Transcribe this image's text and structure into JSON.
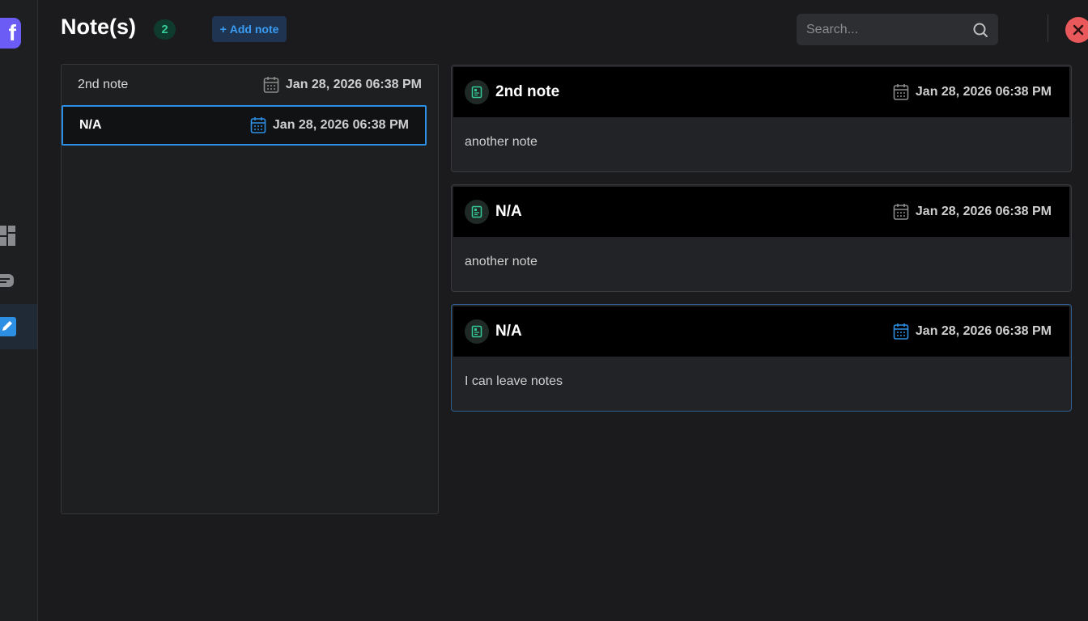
{
  "header": {
    "title": "Note(s)",
    "count": "2",
    "add_label": "Add note",
    "add_plus": "+",
    "search_placeholder": "Search..."
  },
  "list": [
    {
      "name": "2nd note",
      "date": "Jan 28, 2026 06:38 PM",
      "selected": false
    },
    {
      "name": "N/A",
      "date": "Jan 28, 2026 06:38 PM",
      "selected": true
    }
  ],
  "cards": [
    {
      "title": "2nd note",
      "date": "Jan 28, 2026 06:38 PM",
      "body": "another note",
      "selected": false
    },
    {
      "title": "N/A",
      "date": "Jan 28, 2026 06:38 PM",
      "body": "another note",
      "selected": false
    },
    {
      "title": "N/A",
      "date": "Jan 28, 2026 06:38 PM",
      "body": "I can leave notes",
      "selected": true
    }
  ],
  "rail": {
    "logo_letter": "f",
    "icons": [
      "dashboard-icon",
      "chat-icon",
      "edit-icon"
    ]
  },
  "colors": {
    "accent_blue": "#2d8fe3",
    "badge_green": "#35c995",
    "close_red": "#e9595c",
    "logo_purple": "#6a5cf5"
  }
}
